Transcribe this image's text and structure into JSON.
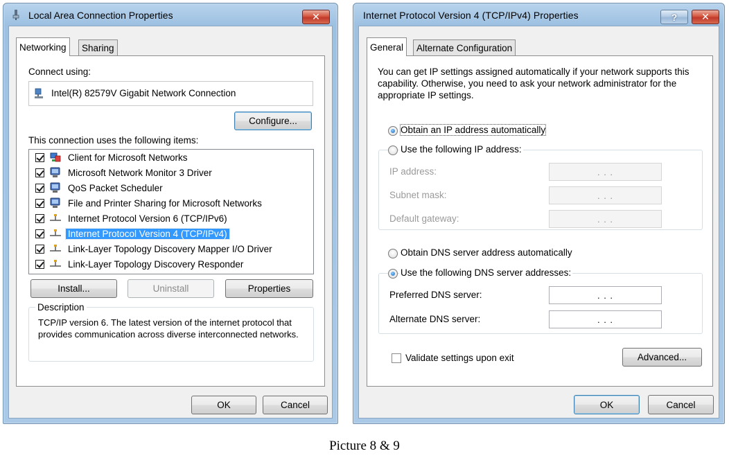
{
  "caption": "Picture 8 & 9",
  "lan_dialog": {
    "title": "Local Area Connection Properties",
    "close_label": "✕",
    "tabs": [
      "Networking",
      "Sharing"
    ],
    "connect_using_label": "Connect using:",
    "adapter_name": "Intel(R) 82579V Gigabit Network Connection",
    "configure_label": "Configure...",
    "items_label": "This connection uses the following items:",
    "items": [
      {
        "label": "Client for Microsoft Networks",
        "checked": true,
        "icon": "network-client-icon"
      },
      {
        "label": "Microsoft Network Monitor 3 Driver",
        "checked": true,
        "icon": "network-service-icon"
      },
      {
        "label": "QoS Packet Scheduler",
        "checked": true,
        "icon": "network-service-icon"
      },
      {
        "label": "File and Printer Sharing for Microsoft Networks",
        "checked": true,
        "icon": "network-service-icon"
      },
      {
        "label": "Internet Protocol Version 6 (TCP/IPv6)",
        "checked": true,
        "icon": "protocol-icon"
      },
      {
        "label": "Internet Protocol Version 4 (TCP/IPv4)",
        "checked": true,
        "icon": "protocol-icon",
        "selected": true
      },
      {
        "label": "Link-Layer Topology Discovery Mapper I/O Driver",
        "checked": true,
        "icon": "protocol-icon"
      },
      {
        "label": "Link-Layer Topology Discovery Responder",
        "checked": true,
        "icon": "protocol-icon"
      }
    ],
    "install_label": "Install...",
    "uninstall_label": "Uninstall",
    "properties_label": "Properties",
    "description_heading": "Description",
    "description_text": "TCP/IP version 6. The latest version of the internet protocol that provides communication across diverse interconnected networks.",
    "ok_label": "OK",
    "cancel_label": "Cancel"
  },
  "ipv4_dialog": {
    "title": "Internet Protocol Version 4 (TCP/IPv4) Properties",
    "help_label": "?",
    "close_label": "✕",
    "tabs": [
      "General",
      "Alternate Configuration"
    ],
    "intro_text": "You can get IP settings assigned automatically if your network supports this capability. Otherwise, you need to ask your network administrator for the appropriate IP settings.",
    "obtain_ip_auto": "Obtain an IP address automatically",
    "use_following_ip": "Use the following IP address:",
    "ip_address_label": "IP address:",
    "subnet_mask_label": "Subnet mask:",
    "default_gateway_label": "Default gateway:",
    "obtain_dns_auto": "Obtain DNS server address automatically",
    "use_following_dns": "Use the following DNS server addresses:",
    "preferred_dns_label": "Preferred DNS server:",
    "alternate_dns_label": "Alternate DNS server:",
    "empty_ip": ".   .   .",
    "validate_label": "Validate settings upon exit",
    "advanced_label": "Advanced...",
    "ok_label": "OK",
    "cancel_label": "Cancel"
  }
}
